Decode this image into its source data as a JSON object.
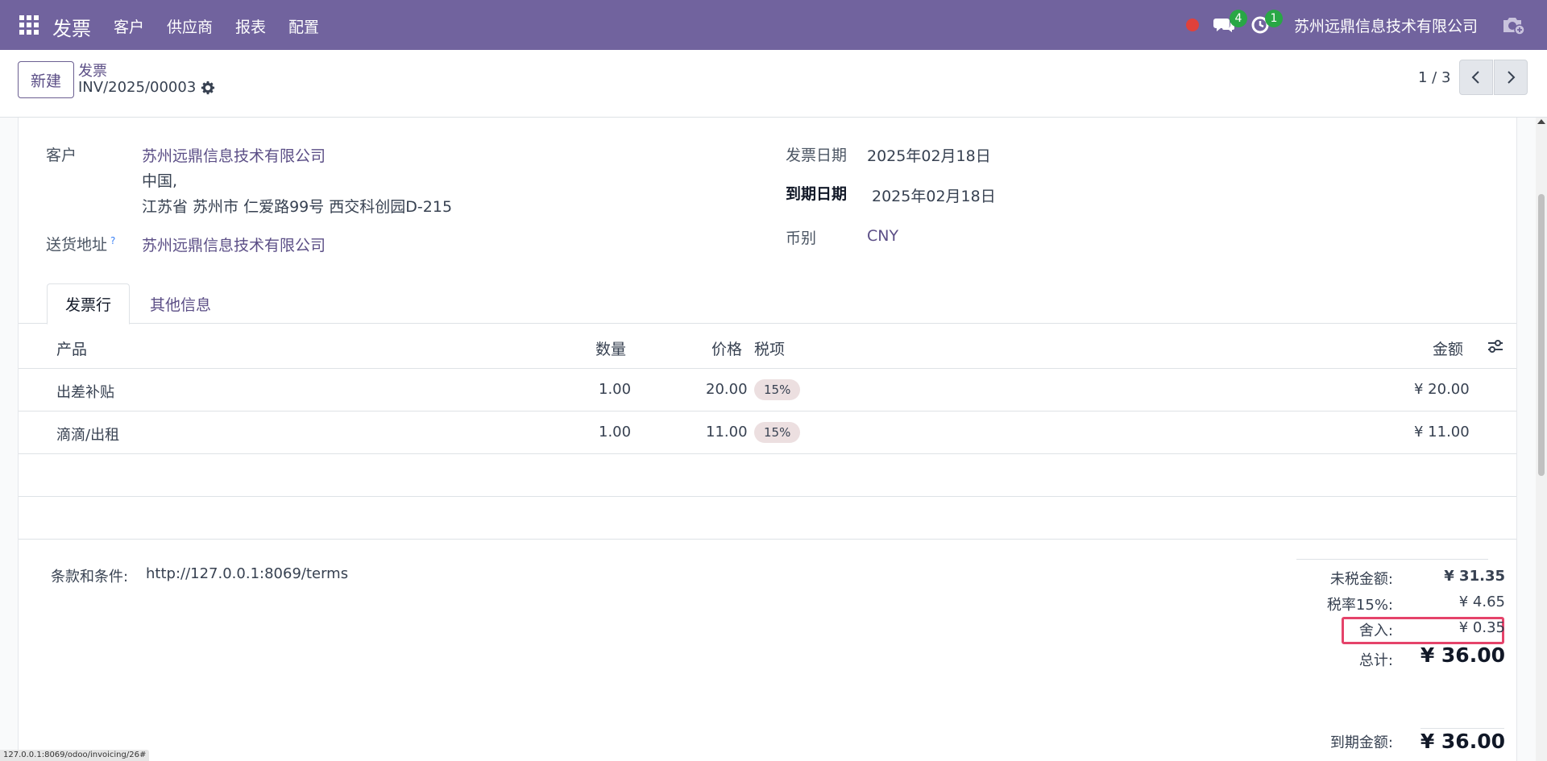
{
  "navbar": {
    "app_name": "发票",
    "menu": [
      "客户",
      "供应商",
      "报表",
      "配置"
    ],
    "messages_count": "4",
    "activities_count": "1",
    "company": "苏州远鼎信息技术有限公司"
  },
  "control_panel": {
    "new_label": "新建",
    "breadcrumb_parent": "发票",
    "record_name": "INV/2025/00003",
    "pager": "1 / 3"
  },
  "form": {
    "customer_label": "客户",
    "customer_name": "苏州远鼎信息技术有限公司",
    "customer_addr1": "中国,",
    "customer_addr2": "江苏省 苏州市 仁爱路99号 西交科创园D-215",
    "delivery_label": "送货地址",
    "delivery_help": "?",
    "delivery_value": "苏州远鼎信息技术有限公司",
    "invoice_date_label": "发票日期",
    "invoice_date": "2025年02月18日",
    "due_date_label": "到期日期",
    "due_date": "2025年02月18日",
    "currency_label": "币别",
    "currency": "CNY"
  },
  "tabs": [
    "发票行",
    "其他信息"
  ],
  "table": {
    "headers": {
      "product": "产品",
      "quantity": "数量",
      "price": "价格",
      "taxes": "税项",
      "amount": "金额"
    },
    "rows": [
      {
        "product": "出差补贴",
        "quantity": "1.00",
        "price": "20.00",
        "tax": "15%",
        "amount": "¥ 20.00"
      },
      {
        "product": "滴滴/出租",
        "quantity": "1.00",
        "price": "11.00",
        "tax": "15%",
        "amount": "¥ 11.00"
      }
    ]
  },
  "terms": {
    "label": "条款和条件:",
    "value": "http://127.0.0.1:8069/terms"
  },
  "totals": {
    "untaxed_label": "未税金额:",
    "untaxed_value": "¥ 31.35",
    "tax_label": "税率15%:",
    "tax_value": "¥ 4.65",
    "rounding_label": "舍入:",
    "rounding_value": "¥ 0.35",
    "total_label": "总计:",
    "total_value": "¥ 36.00",
    "due_label": "到期金额:",
    "due_value": "¥ 36.00"
  },
  "status_url": "127.0.0.1:8069/odoo/invoicing/26#",
  "colors": {
    "navbar": "#71639e",
    "link": "#5b4e86",
    "highlight": "#e5436a",
    "tax_badge": "#ecdfe0"
  }
}
